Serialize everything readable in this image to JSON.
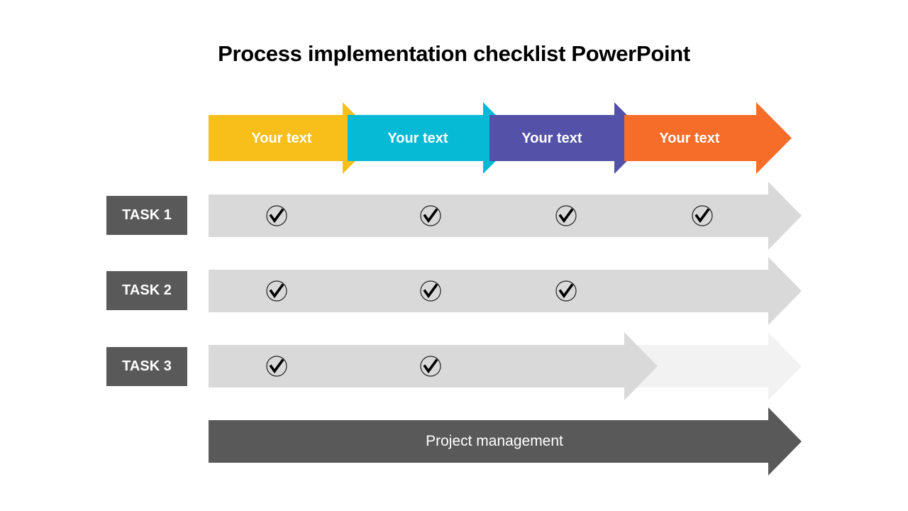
{
  "title": "Process implementation checklist PowerPoint",
  "steps": [
    {
      "label": "Your text",
      "color": "#F8BE19"
    },
    {
      "label": "Your text",
      "color": "#06B9D5"
    },
    {
      "label": "Your text",
      "color": "#5352A8"
    },
    {
      "label": "Your text",
      "color": "#F66D2A"
    }
  ],
  "tasks": [
    {
      "label": "TASK 1",
      "completed_steps": 4
    },
    {
      "label": "TASK 2",
      "completed_steps": 3
    },
    {
      "label": "TASK 3",
      "completed_steps": 2
    }
  ],
  "total_steps": 4,
  "footer_label": "Project management",
  "colors": {
    "task_label_bg": "#595959",
    "progress_fill": "#D9D9D9",
    "progress_track": "#F2F2F2",
    "footer_bg": "#595959"
  },
  "icons": {
    "check": "check-circle-icon"
  }
}
